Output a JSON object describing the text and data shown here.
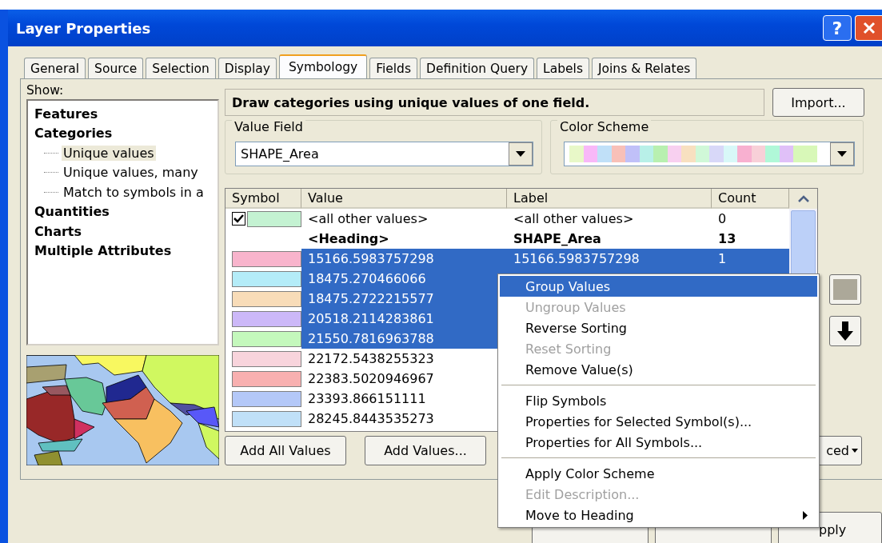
{
  "window": {
    "title": "Layer Properties",
    "help_button": "?"
  },
  "tabs": [
    {
      "label": "General",
      "selected": false
    },
    {
      "label": "Source",
      "selected": false
    },
    {
      "label": "Selection",
      "selected": false
    },
    {
      "label": "Display",
      "selected": false
    },
    {
      "label": "Symbology",
      "selected": true
    },
    {
      "label": "Fields",
      "selected": false
    },
    {
      "label": "Definition Query",
      "selected": false
    },
    {
      "label": "Labels",
      "selected": false
    },
    {
      "label": "Joins & Relates",
      "selected": false
    }
  ],
  "show": {
    "label": "Show:",
    "items": [
      {
        "label": "Features",
        "selected": false
      },
      {
        "label": "Categories",
        "selected": false,
        "children": [
          {
            "label": "Unique values",
            "selected": true
          },
          {
            "label": "Unique values, many",
            "selected": false
          },
          {
            "label": "Match to symbols in a",
            "selected": false
          }
        ]
      },
      {
        "label": "Quantities",
        "selected": false
      },
      {
        "label": "Charts",
        "selected": false
      },
      {
        "label": "Multiple Attributes",
        "selected": false
      }
    ]
  },
  "description": "Draw categories using unique values of one field.",
  "import_button": "Import...",
  "value_field": {
    "label": "Value Field",
    "value": "SHAPE_Area"
  },
  "color_scheme": {
    "label": "Color Scheme",
    "swatches": [
      {
        "color": "#e8f8c8"
      },
      {
        "color": "#f8b8f8"
      },
      {
        "color": "#c0e0f8"
      },
      {
        "color": "#f8c0b8"
      },
      {
        "color": "#c0c0f8"
      },
      {
        "color": "#b8f0e8"
      },
      {
        "color": "#b8f0b0"
      },
      {
        "color": "#f8d0f0"
      },
      {
        "color": "#f8e0c0"
      },
      {
        "color": "#d0f8d8"
      },
      {
        "color": "#d8d8f8"
      },
      {
        "color": "#d8f8f8"
      },
      {
        "color": "#f8b0d0"
      },
      {
        "color": "#f8d0d8"
      },
      {
        "color": "#b0f8d8"
      },
      {
        "color": "#e0c0f8"
      },
      {
        "color": "#d8f8b8"
      }
    ]
  },
  "table": {
    "columns": [
      "Symbol",
      "Value",
      "Label",
      "Count"
    ],
    "rows": [
      {
        "kind": "other",
        "checked": true,
        "color": "#c4f2d2",
        "value": "<all other values>",
        "label": "<all other values>",
        "count": "0",
        "selected": false
      },
      {
        "kind": "heading",
        "value": "<Heading>",
        "label": "SHAPE_Area",
        "count": "13",
        "selected": false
      },
      {
        "kind": "value",
        "color": "#f8b4cc",
        "value": "15166.5983757298",
        "label": "15166.5983757298",
        "count": "1",
        "selected": true
      },
      {
        "kind": "value",
        "color": "#b4ecf8",
        "value": "18475.270466066",
        "selected": true
      },
      {
        "kind": "value",
        "color": "#f8dcb8",
        "value": "18475.2722215577",
        "selected": true
      },
      {
        "kind": "value",
        "color": "#ccb8f8",
        "value": "20518.2114283861",
        "selected": true
      },
      {
        "kind": "value",
        "color": "#c4f8bc",
        "value": "21550.7816963788",
        "selected": true
      },
      {
        "kind": "value",
        "color": "#f8d4dc",
        "value": "22172.5438255323",
        "selected": false
      },
      {
        "kind": "value",
        "color": "#f8b0b0",
        "value": "22383.5020946967",
        "selected": false
      },
      {
        "kind": "value",
        "color": "#b4c8f8",
        "value": "23393.866151111",
        "selected": false
      },
      {
        "kind": "value",
        "color": "#c0e0f8",
        "value": "28245.8443535273",
        "selected": false
      }
    ]
  },
  "add_buttons": [
    "Add All Values",
    "Add Values..."
  ],
  "advanced_button": "ced",
  "apply_button": "pply",
  "context_menu": {
    "items": [
      {
        "kind": "item",
        "label": "Group Values",
        "selected": true,
        "disabled": false,
        "submenu": false
      },
      {
        "kind": "item",
        "label": "Ungroup Values",
        "selected": false,
        "disabled": true,
        "submenu": false
      },
      {
        "kind": "item",
        "label": "Reverse Sorting",
        "selected": false,
        "disabled": false,
        "submenu": false
      },
      {
        "kind": "item",
        "label": "Reset Sorting",
        "selected": false,
        "disabled": true,
        "submenu": false
      },
      {
        "kind": "item",
        "label": "Remove Value(s)",
        "selected": false,
        "disabled": false,
        "submenu": false
      },
      {
        "kind": "separator"
      },
      {
        "kind": "item",
        "label": "Flip Symbols",
        "selected": false,
        "disabled": false,
        "submenu": false
      },
      {
        "kind": "item",
        "label": "Properties for Selected Symbol(s)...",
        "selected": false,
        "disabled": false,
        "submenu": false
      },
      {
        "kind": "item",
        "label": "Properties for All Symbols...",
        "selected": false,
        "disabled": false,
        "submenu": false
      },
      {
        "kind": "separator"
      },
      {
        "kind": "item",
        "label": "Apply Color Scheme",
        "selected": false,
        "disabled": false,
        "submenu": false
      },
      {
        "kind": "item",
        "label": "Edit Description...",
        "selected": false,
        "disabled": true,
        "submenu": false
      },
      {
        "kind": "item",
        "label": "Move to Heading",
        "selected": false,
        "disabled": false,
        "submenu": true
      }
    ]
  }
}
